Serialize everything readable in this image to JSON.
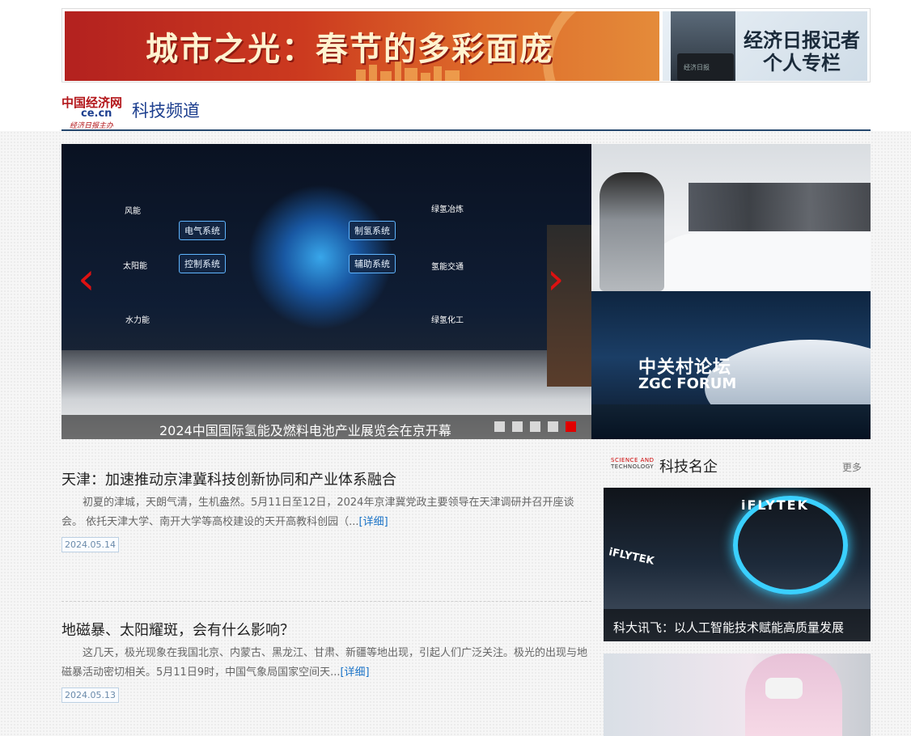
{
  "banner": {
    "left_title": "城市之光：春节的多彩面庞",
    "right_text_line1": "经济日报记者",
    "right_text_line2": "个人专栏",
    "right_laptop_text": "经济日报"
  },
  "header": {
    "logo_main": "中国经济网",
    "logo_domain": "ce.cn",
    "logo_sub": "经济日报主办",
    "channel": "科技频道"
  },
  "slider": {
    "caption": "2024中国国际氢能及燃料电池产业展览会在京开幕",
    "nodes": [
      "电气系统",
      "制氢系统",
      "控制系统",
      "辅助系统"
    ],
    "side_labels": [
      "风能",
      "太阳能",
      "水力能",
      "绿氢冶炼",
      "氢能交通",
      "绿氢化工"
    ],
    "dots_count": 5,
    "active_dot": 5,
    "prev_icon": "chevron-left-icon",
    "next_icon": "chevron-right-icon"
  },
  "side_images": {
    "image2_text_cn": "中关村论坛",
    "image2_text_en": "ZGC FORUM"
  },
  "articles": [
    {
      "title": "天津：加速推动京津冀科技创新协同和产业体系融合",
      "body": "初夏的津城，天朗气清，生机盎然。5月11日至12日，2024年京津冀党政主要领导在天津调研并召开座谈会。 依托天津大学、南开大学等高校建设的天开高教科创园（...",
      "more": "[详细]",
      "date": "2024.05.14"
    },
    {
      "title": "地磁暴、太阳耀斑，会有什么影响？",
      "body": "这几天，极光现象在我国北京、内蒙古、黑龙江、甘肃、新疆等地出现，引起人们广泛关注。极光的出现与地磁暴活动密切相关。5月11日9时，中国气象局国家空间天...",
      "more": "[详细]",
      "date": "2024.05.13"
    }
  ],
  "right_column": {
    "logo_line1": "SCIENCE AND",
    "logo_line2": "TECHNOLOGY",
    "title": "科技名企",
    "more": "更多",
    "card1_brand": "iFLYTEK",
    "card1_caption": "科大讯飞：以人工智能技术赋能高质量发展"
  },
  "colors": {
    "brand_red": "#b3161a",
    "brand_blue": "#1d3f8f",
    "header_line": "#25476d",
    "active_dot": "#e00000",
    "link": "#1a73c7"
  }
}
